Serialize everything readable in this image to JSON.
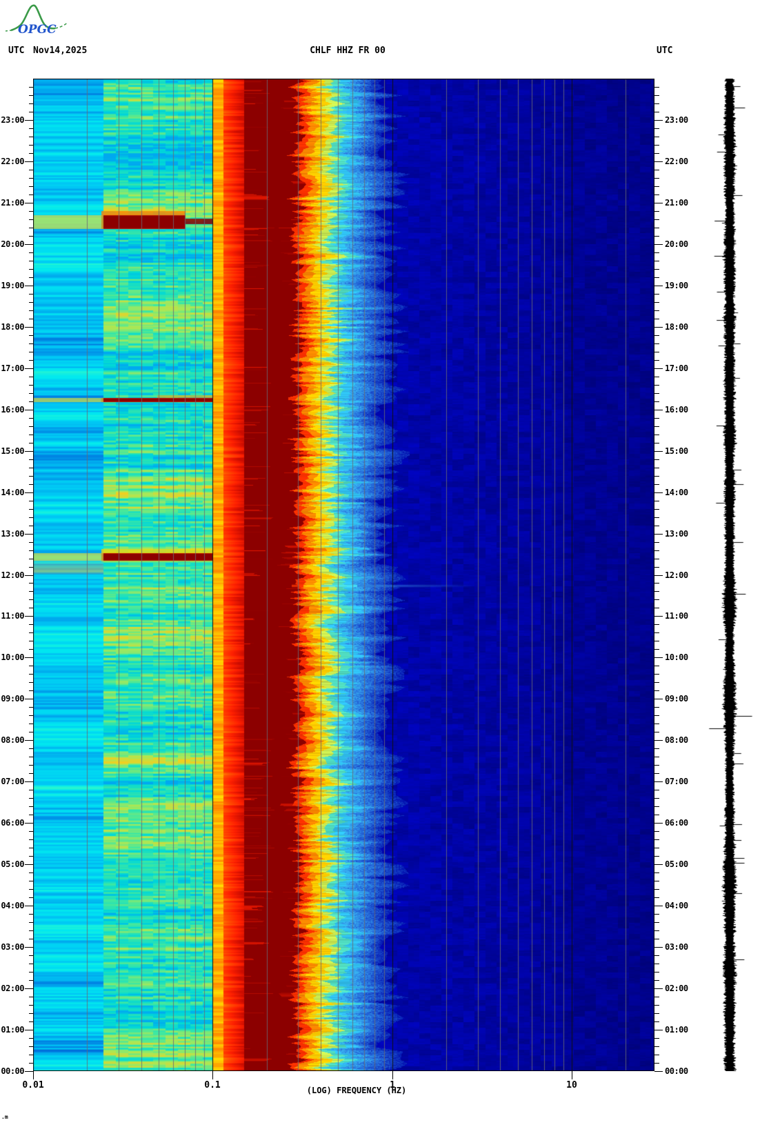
{
  "header": {
    "logo_text": "OPGC",
    "utc_left": "UTC",
    "date": "Nov14,2025",
    "title": "CHLF HHZ FR 00",
    "utc_right": "UTC"
  },
  "footer_mark": ".m",
  "axes": {
    "x": {
      "label": "(LOG) FREQUENCY (HZ)",
      "scale": "log",
      "min_hz": 0.01,
      "max_hz": 29,
      "ticks": [
        {
          "label": "0.01",
          "hz": 0.01
        },
        {
          "label": "0.1",
          "hz": 0.1
        },
        {
          "label": "1",
          "hz": 1
        },
        {
          "label": "10",
          "hz": 10
        }
      ]
    },
    "y": {
      "unit": "UTC",
      "minor_tick_minutes": 12,
      "hour_labels": [
        "23:00",
        "22:00",
        "21:00",
        "20:00",
        "19:00",
        "18:00",
        "17:00",
        "16:00",
        "15:00",
        "14:00",
        "13:00",
        "12:00",
        "11:00",
        "10:00",
        "09:00",
        "08:00",
        "07:00",
        "06:00",
        "05:00",
        "04:00",
        "03:00",
        "02:00",
        "01:00",
        "00:00"
      ]
    }
  },
  "chart_data": {
    "type": "heatmap",
    "title": "CHLF HHZ FR 00",
    "date": "Nov14,2025",
    "x_axis": {
      "label": "(LOG) FREQUENCY (HZ)",
      "scale": "log",
      "min_hz": 0.01,
      "max_hz": 29,
      "decade_ticks": [
        0.01,
        0.1,
        1,
        10
      ]
    },
    "y_axis": {
      "unit": "UTC",
      "top": "24:00",
      "bottom": "00:00",
      "hours_span": 24,
      "minor_tick_minutes": 12
    },
    "colormap": [
      "#000080",
      "#0000a8",
      "#2060d8",
      "#00a8f0",
      "#00e8d0",
      "#80ee70",
      "#ffd820",
      "#ff8800",
      "#ff3000",
      "#8b0000"
    ],
    "gridlines": {
      "vertical_log_minor_color": "#6a6a74",
      "vertical_decade_color": "#101010"
    },
    "frequency_bands": [
      {
        "name": "long-period",
        "from_hz": 0.01,
        "to_hz": 0.024,
        "texture": "horizontal-stripes",
        "colors": [
          "#0064d8",
          "#00a0ec",
          "#00c8f4",
          "#00e8f0",
          "#30f8c8"
        ]
      },
      {
        "name": "low",
        "from_hz": 0.024,
        "to_hz": 0.1,
        "texture": "mottled",
        "colors": [
          "#00a8f0",
          "#00d8d8",
          "#40e8a0",
          "#a8e858",
          "#f0d020"
        ]
      },
      {
        "name": "yellow-edge",
        "from_hz": 0.1,
        "to_hz": 0.115,
        "texture": "mottled",
        "colors": [
          "#ffe800",
          "#ffb400",
          "#ff8000"
        ]
      },
      {
        "name": "orange-red",
        "from_hz": 0.115,
        "to_hz": 0.15,
        "texture": "mottled",
        "colors": [
          "#ff9800",
          "#ff5000",
          "#ff2000",
          "#cc0c00"
        ]
      },
      {
        "name": "microseism-peak",
        "from_hz": 0.15,
        "to_hz": 0.26,
        "texture": "solid-with-streaks",
        "colors": [
          "#8c0000",
          "#e81800"
        ]
      },
      {
        "name": "roll-off",
        "from_hz": 0.26,
        "to_hz": 0.55,
        "texture": "ragged-transition",
        "colors": [
          "#b80000",
          "#ff3000",
          "#ff8800",
          "#ffcc00",
          "#c8e850",
          "#50dcc0",
          "#30c0f0"
        ]
      },
      {
        "name": "speckle-blue",
        "from_hz": 0.55,
        "to_hz": 1.0,
        "texture": "speckled",
        "colors": [
          "#38b0f0",
          "#2870dc",
          "#1238c0",
          "#000cb0"
        ]
      },
      {
        "name": "deep-blue",
        "from_hz": 1.0,
        "to_hz": 29,
        "texture": "smooth-dark",
        "colors": [
          "#0004ac",
          "#000290"
        ]
      }
    ],
    "events": [
      {
        "label": "low-freq-transient",
        "start": "20:22",
        "end": "20:41",
        "from_hz": 0.024,
        "to_hz": 0.07,
        "color": "#8c0000",
        "halo_color": "#ff8000"
      },
      {
        "label": "low-freq-transient",
        "start": "16:11",
        "end": "16:16",
        "from_hz": 0.024,
        "to_hz": 0.1,
        "color": "#8c0000",
        "halo_color": "#ff9800"
      },
      {
        "label": "low-freq-transient",
        "start": "12:21",
        "end": "12:31",
        "from_hz": 0.024,
        "to_hz": 0.1,
        "color": "#8c0000",
        "halo_color": "#ffd800"
      },
      {
        "label": "broadband-streak",
        "start": "11:42",
        "end": "11:46",
        "from_hz": 0.3,
        "to_hz": 2.0,
        "color": "#48e8f8",
        "halo_color": "#ff3800"
      }
    ],
    "seismogram_trace": {
      "color": "#000000",
      "spike_times": [
        "08:17",
        "08:35"
      ]
    }
  }
}
